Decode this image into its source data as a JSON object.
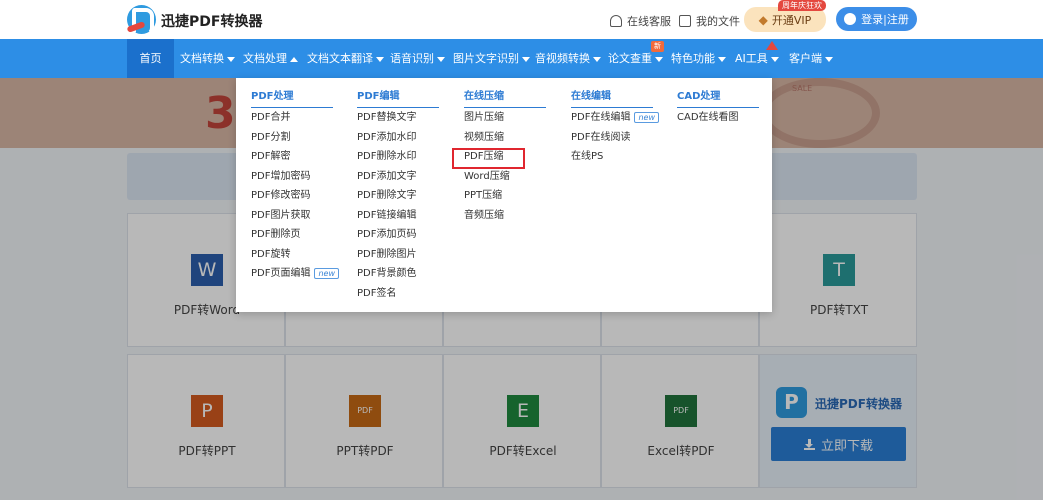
{
  "header": {
    "brand": "迅捷PDF转换器",
    "service": "在线客服",
    "my_files": "我的文件",
    "vip_badge": "周年庆狂欢",
    "vip_label": "开通VIP",
    "login_label": "登录|注册"
  },
  "nav": {
    "items": [
      {
        "label": "首页"
      },
      {
        "label": "文档转换"
      },
      {
        "label": "文档处理"
      },
      {
        "label": "文档文本翻译"
      },
      {
        "label": "语音识别"
      },
      {
        "label": "图片文字识别"
      },
      {
        "label": "音视频转换"
      },
      {
        "label": "论文查重"
      },
      {
        "label": "特色功能"
      },
      {
        "label": "AI工具"
      },
      {
        "label": "客户端"
      }
    ],
    "new_tag": "新"
  },
  "banner": {
    "big_text": "3",
    "sale_text": "SALE"
  },
  "dropdown": {
    "columns": [
      {
        "title": "PDF处理",
        "items": [
          "PDF合并",
          "PDF分割",
          "PDF解密",
          "PDF增加密码",
          "PDF修改密码",
          "PDF图片获取",
          "PDF删除页",
          "PDF旋转",
          "PDF页面编辑"
        ]
      },
      {
        "title": "PDF编辑",
        "items": [
          "PDF替换文字",
          "PDF添加水印",
          "PDF删除水印",
          "PDF添加文字",
          "PDF删除文字",
          "PDF链接编辑",
          "PDF添加页码",
          "PDF删除图片",
          "PDF背景颜色",
          "PDF签名"
        ]
      },
      {
        "title": "在线压缩",
        "items": [
          "图片压缩",
          "视频压缩",
          "PDF压缩",
          "Word压缩",
          "PPT压缩",
          "音频压缩"
        ]
      },
      {
        "title": "在线编辑",
        "items": [
          "PDF在线编辑",
          "PDF在线阅读",
          "在线PS"
        ]
      },
      {
        "title": "CAD处理",
        "items": [
          "CAD在线看图"
        ]
      }
    ],
    "new_label": "new"
  },
  "tools": {
    "row1": [
      {
        "label": "PDF转Word",
        "icon": "W",
        "color": "#2b5fad"
      },
      {
        "label": "PDF转TXT",
        "icon": "T",
        "color": "#2a9a9a"
      }
    ],
    "row2": [
      {
        "label": "PDF转PPT",
        "icon": "P",
        "color": "#d55a1f"
      },
      {
        "label": "PPT转PDF",
        "icon": "PDF",
        "color": "#c66a16"
      },
      {
        "label": "PDF转Excel",
        "icon": "E",
        "color": "#1f8a3f"
      },
      {
        "label": "Excel转PDF",
        "icon": "PDF",
        "color": "#21733c"
      }
    ],
    "promo": {
      "brand": "迅捷PDF转换器",
      "logo": "P",
      "button": "立即下载"
    }
  }
}
